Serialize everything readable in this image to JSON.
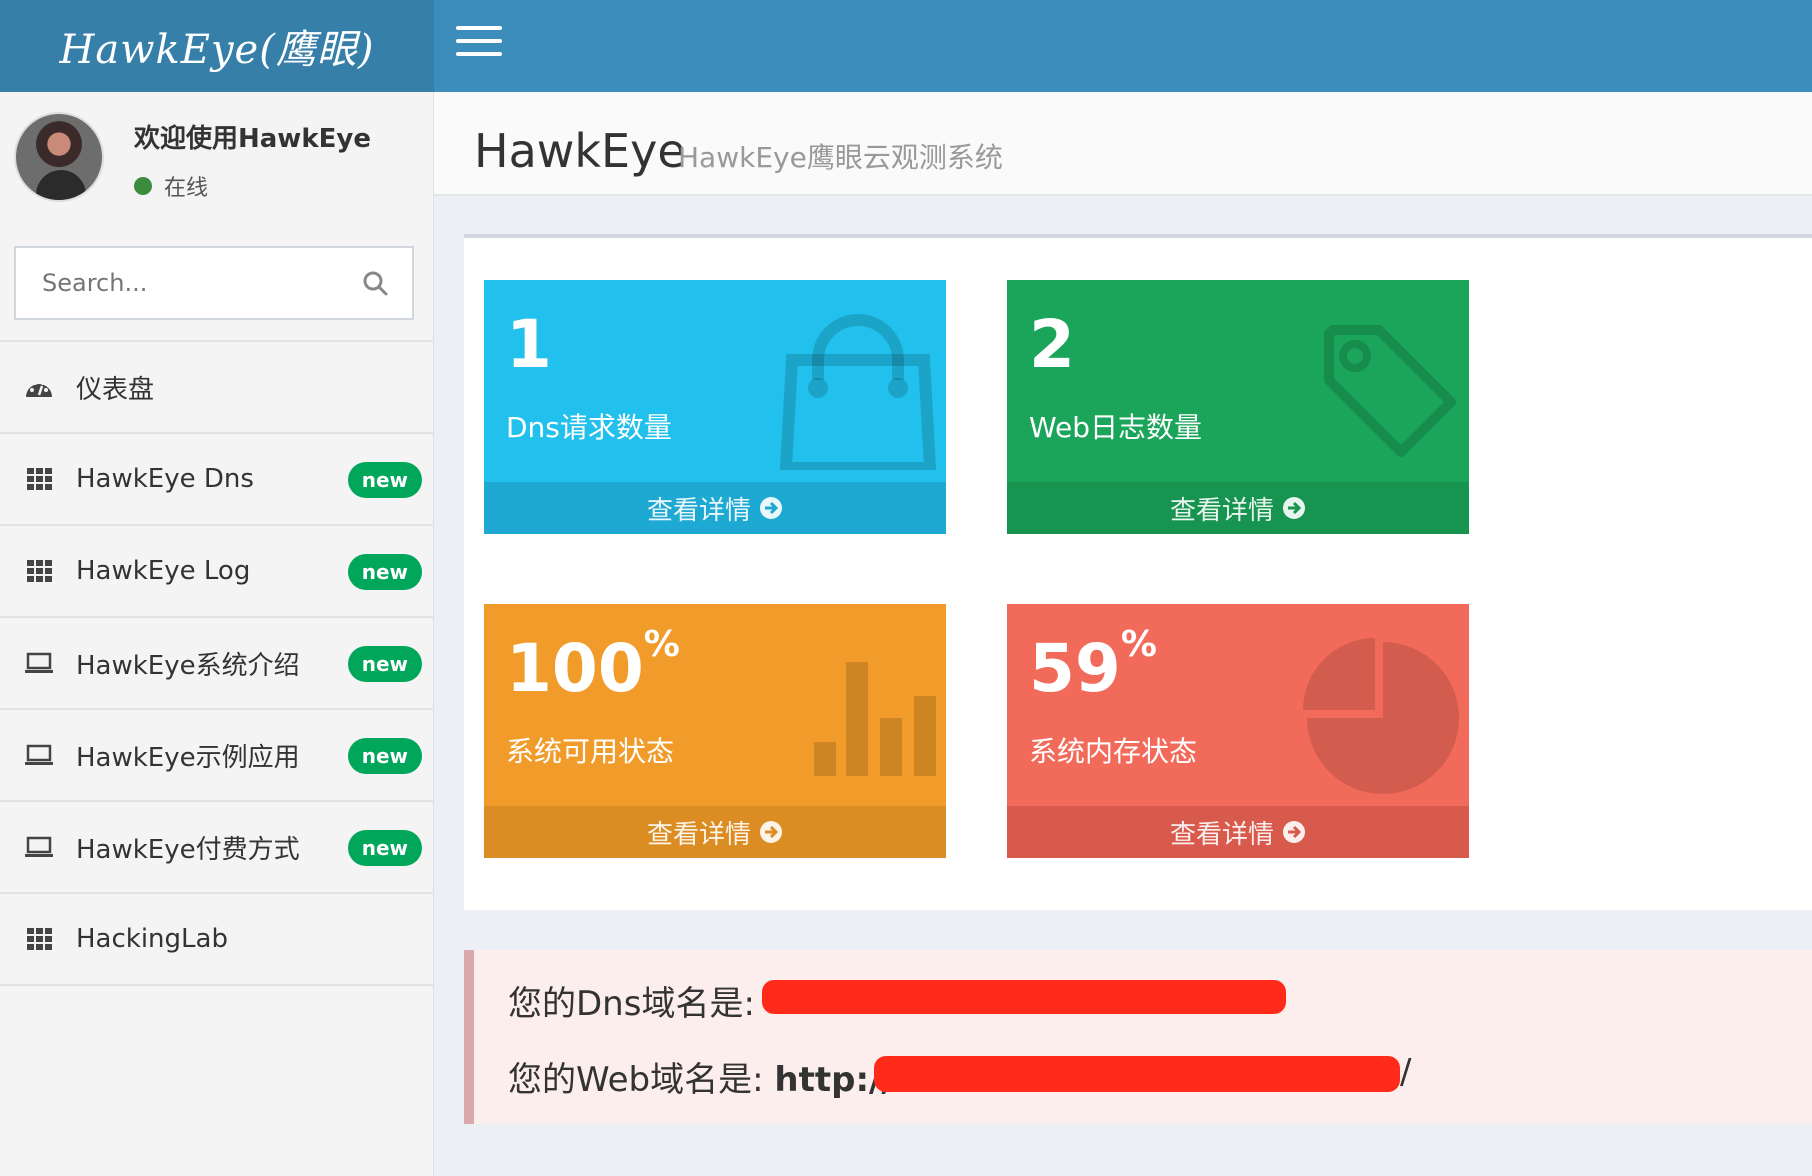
{
  "header": {
    "logo": "HawkEye(鹰眼)"
  },
  "user": {
    "welcome": "欢迎使用HawkEye",
    "status": "在线"
  },
  "search": {
    "placeholder": "Search..."
  },
  "sidebar": {
    "items": [
      {
        "label": "仪表盘",
        "icon": "dashboard-icon"
      },
      {
        "label": "HawkEye Dns",
        "icon": "grid-icon",
        "badge": "new"
      },
      {
        "label": "HawkEye Log",
        "icon": "grid-icon",
        "badge": "new"
      },
      {
        "label": "HawkEye系统介绍",
        "icon": "laptop-icon",
        "badge": "new"
      },
      {
        "label": "HawkEye示例应用",
        "icon": "laptop-icon",
        "badge": "new"
      },
      {
        "label": "HawkEye付费方式",
        "icon": "laptop-icon",
        "badge": "new"
      },
      {
        "label": "HackingLab",
        "icon": "grid-icon"
      }
    ]
  },
  "page": {
    "title": "HawkEye",
    "subtitle": "HawkEye鹰眼云观测系统"
  },
  "stats": [
    {
      "value": "1",
      "suffix": "",
      "label": "Dns请求数量",
      "link": "查看详情",
      "color": "#22c0ec",
      "icon": "shopping-bag-icon"
    },
    {
      "value": "2",
      "suffix": "",
      "label": "Web日志数量",
      "link": "查看详情",
      "color": "#1aa55b",
      "icon": "tag-icon"
    },
    {
      "value": "100",
      "suffix": "%",
      "label": "系统可用状态",
      "link": "查看详情",
      "color": "#f19c2a",
      "icon": "bar-chart-icon"
    },
    {
      "value": "59",
      "suffix": "%",
      "label": "系统内存状态",
      "link": "查看详情",
      "color": "#f26a5a",
      "icon": "pie-chart-icon"
    }
  ],
  "callout": {
    "dns_label": "您的Dns域名是:",
    "web_label": "您的Web域名是: ",
    "web_prefix": "http://",
    "web_suffix": "/"
  }
}
